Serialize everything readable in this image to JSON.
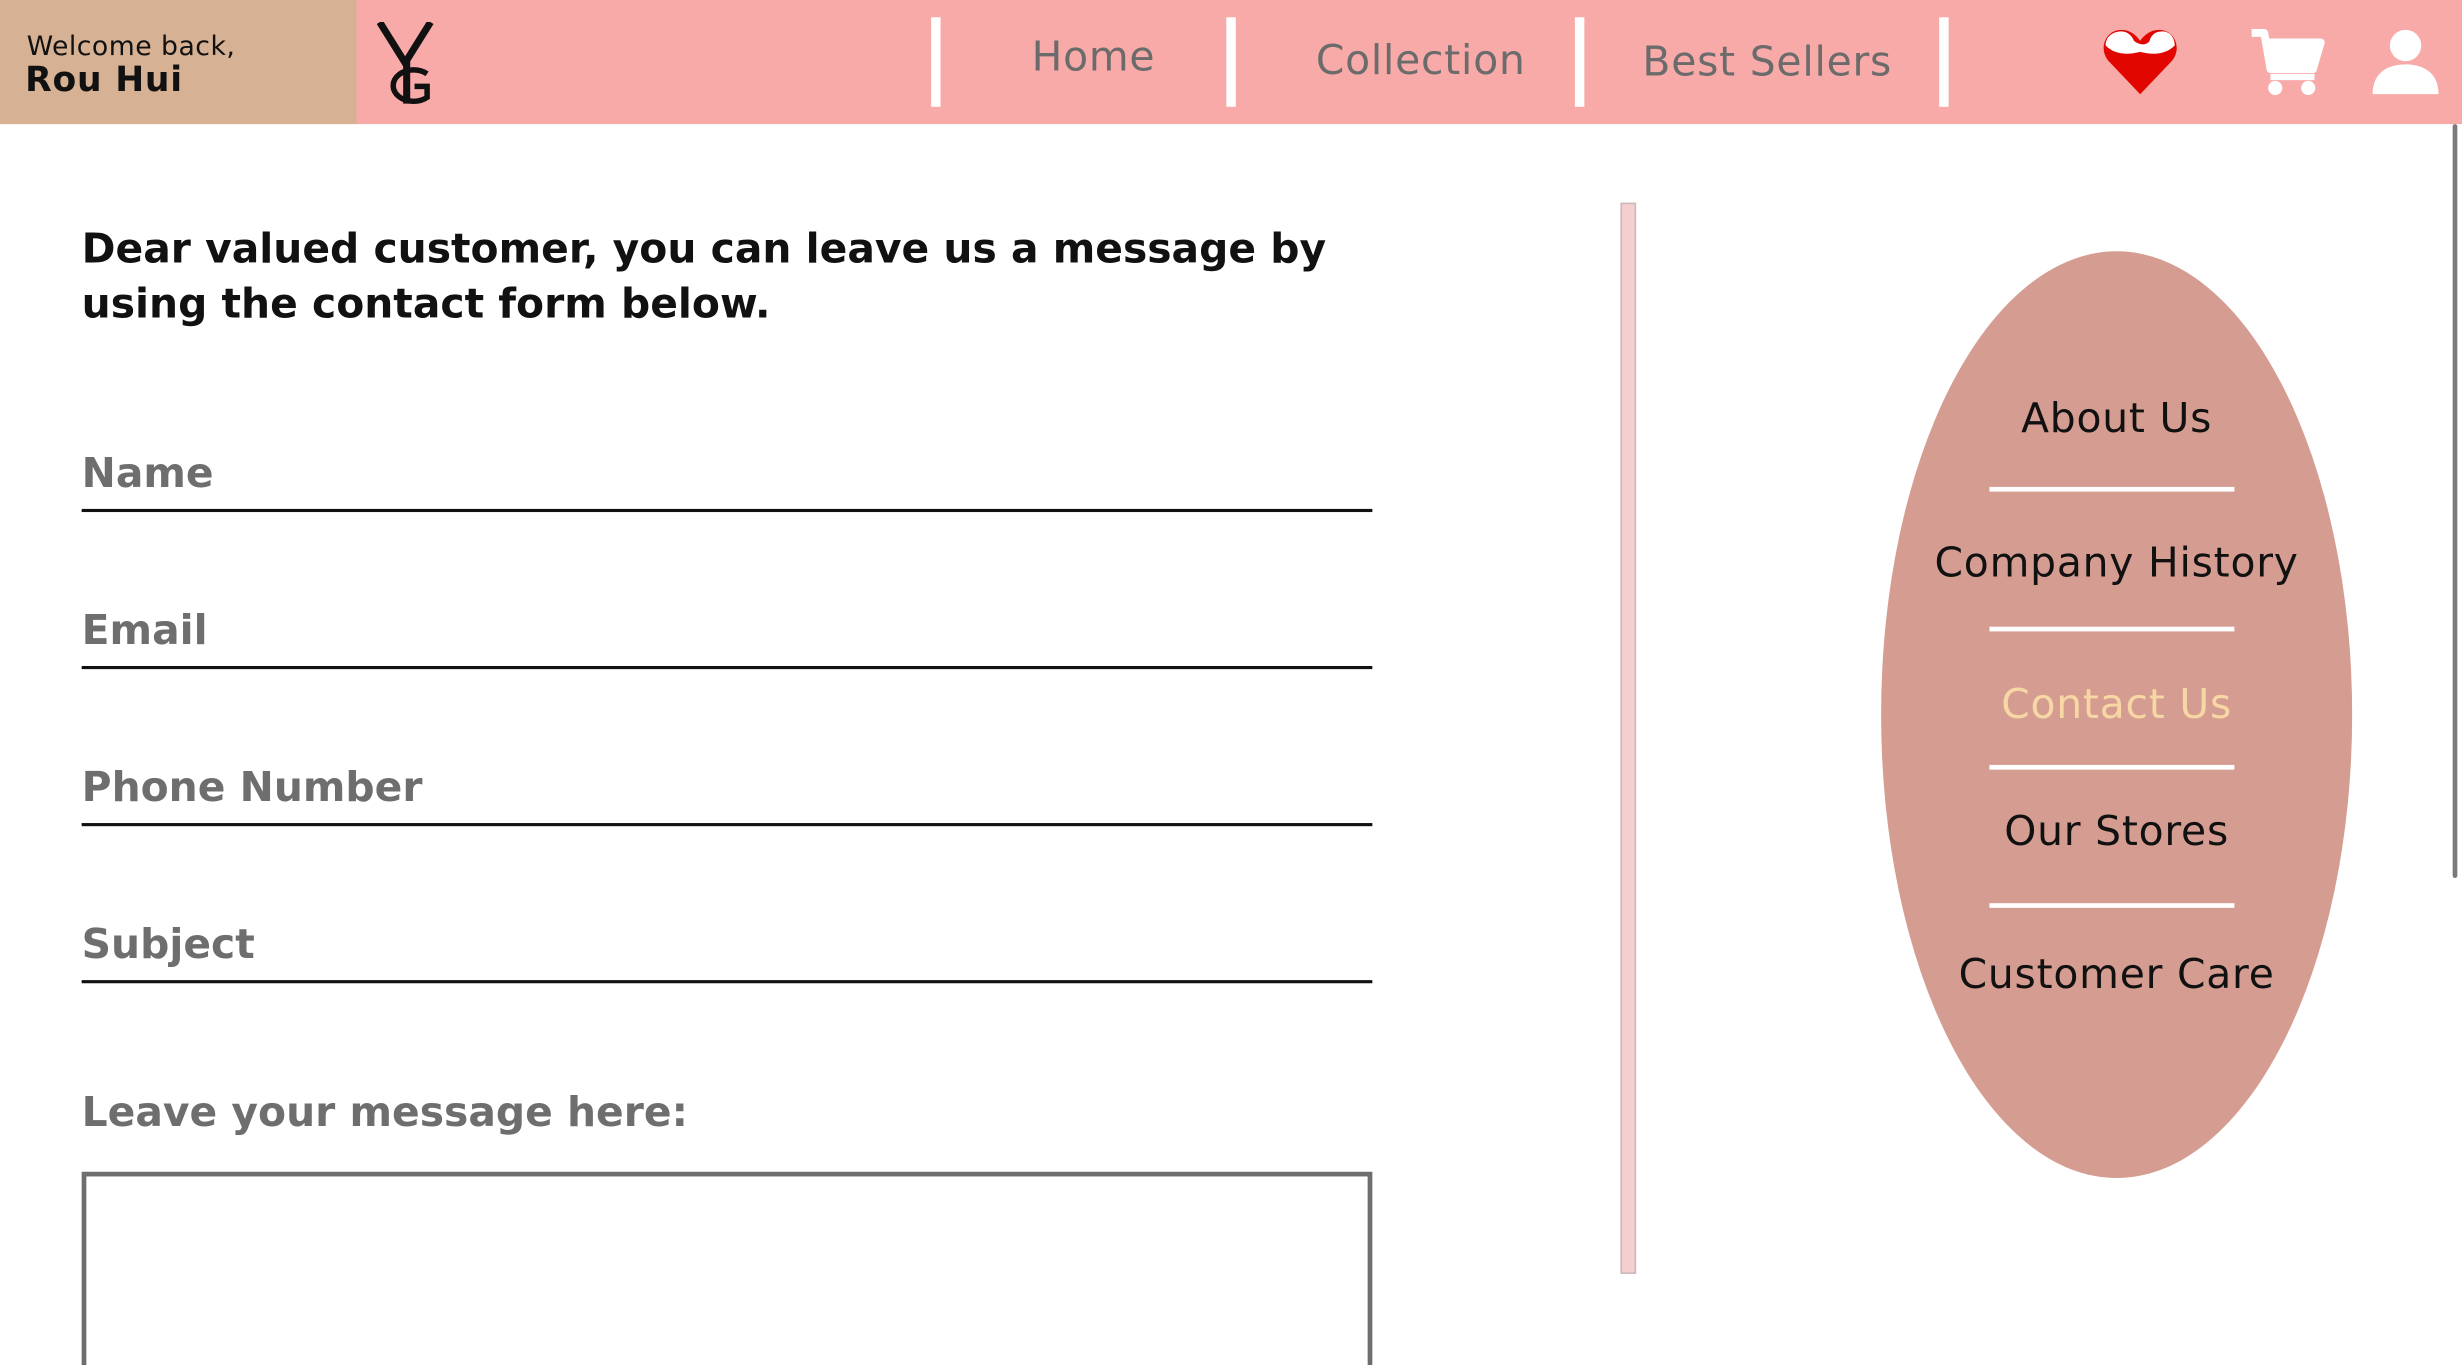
{
  "header": {
    "welcome_text": "Welcome back,",
    "user_name": "Rou Hui",
    "nav": [
      {
        "label": "Home"
      },
      {
        "label": "Collection"
      },
      {
        "label": "Best Sellers"
      }
    ],
    "icons": [
      "heart-icon",
      "cart-icon",
      "user-icon"
    ],
    "colors": {
      "bar": "#f8aaa9",
      "welcome_box": "#d6b193",
      "heart": "#e10600"
    }
  },
  "main": {
    "intro": "Dear valued customer, you can leave us a message by using the contact form below.",
    "form": {
      "name_placeholder": "Name",
      "email_placeholder": "Email",
      "phone_placeholder": "Phone Number",
      "subject_placeholder": "Subject",
      "message_label": "Leave your message here:"
    }
  },
  "side_menu": {
    "items": [
      {
        "label": "About Us"
      },
      {
        "label": "Company History"
      },
      {
        "label": "Contact Us",
        "active": true
      },
      {
        "label": "Our Stores"
      },
      {
        "label": "Customer Care"
      }
    ],
    "colors": {
      "background": "#d59d91",
      "active_text": "#f7d7a4"
    }
  }
}
